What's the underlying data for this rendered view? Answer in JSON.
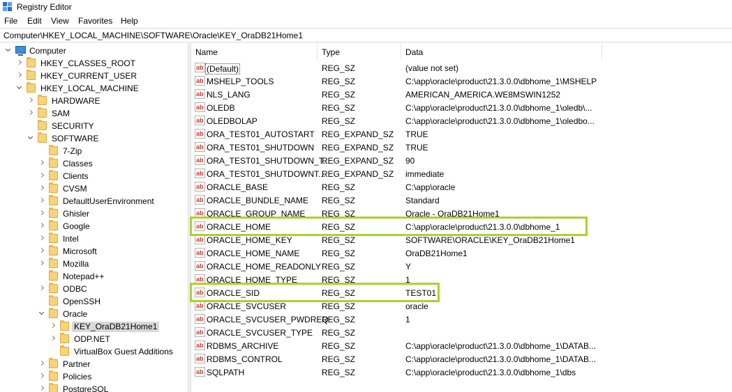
{
  "window": {
    "title": "Registry Editor"
  },
  "menu": [
    "File",
    "Edit",
    "View",
    "Favorites",
    "Help"
  ],
  "address": "Computer\\HKEY_LOCAL_MACHINE\\SOFTWARE\\Oracle\\KEY_OraDB21Home1",
  "tree": [
    {
      "label": "Computer",
      "expander": "open",
      "icon": "computer-icon"
    },
    {
      "label": "HKEY_CLASSES_ROOT",
      "expander": "closed",
      "icon": "folder-icon"
    },
    {
      "label": "HKEY_CURRENT_USER",
      "expander": "closed",
      "icon": "folder-icon"
    },
    {
      "label": "HKEY_LOCAL_MACHINE",
      "expander": "open",
      "icon": "folder-icon"
    },
    {
      "label": "HARDWARE",
      "expander": "closed",
      "icon": "folder-icon"
    },
    {
      "label": "SAM",
      "expander": "closed",
      "icon": "folder-icon"
    },
    {
      "label": "SECURITY",
      "expander": "none",
      "icon": "folder-icon"
    },
    {
      "label": "SOFTWARE",
      "expander": "open",
      "icon": "folder-icon"
    },
    {
      "label": "7-Zip",
      "expander": "none",
      "icon": "folder-icon"
    },
    {
      "label": "Classes",
      "expander": "closed",
      "icon": "folder-icon"
    },
    {
      "label": "Clients",
      "expander": "closed",
      "icon": "folder-icon"
    },
    {
      "label": "CVSM",
      "expander": "closed",
      "icon": "folder-icon"
    },
    {
      "label": "DefaultUserEnvironment",
      "expander": "closed",
      "icon": "folder-icon"
    },
    {
      "label": "Ghisler",
      "expander": "closed",
      "icon": "folder-icon"
    },
    {
      "label": "Google",
      "expander": "closed",
      "icon": "folder-icon"
    },
    {
      "label": "Intel",
      "expander": "closed",
      "icon": "folder-icon"
    },
    {
      "label": "Microsoft",
      "expander": "closed",
      "icon": "folder-icon"
    },
    {
      "label": "Mozilla",
      "expander": "closed",
      "icon": "folder-icon"
    },
    {
      "label": "Notepad++",
      "expander": "none",
      "icon": "folder-icon"
    },
    {
      "label": "ODBC",
      "expander": "closed",
      "icon": "folder-icon"
    },
    {
      "label": "OpenSSH",
      "expander": "none",
      "icon": "folder-icon"
    },
    {
      "label": "Oracle",
      "expander": "open",
      "icon": "folder-icon"
    },
    {
      "label": "KEY_OraDB21Home1",
      "expander": "closed",
      "icon": "folder-icon",
      "selected": true
    },
    {
      "label": "ODP.NET",
      "expander": "closed",
      "icon": "folder-icon"
    },
    {
      "label": "VirtualBox Guest Additions",
      "expander": "none",
      "icon": "folder-icon"
    },
    {
      "label": "Partner",
      "expander": "closed",
      "icon": "folder-icon"
    },
    {
      "label": "Policies",
      "expander": "closed",
      "icon": "folder-icon"
    },
    {
      "label": "PostgreSQL",
      "expander": "closed",
      "icon": "folder-icon"
    }
  ],
  "columns": [
    "Name",
    "Type",
    "Data"
  ],
  "values": [
    {
      "name": "(Default)",
      "type": "REG_SZ",
      "data": "(value not set)"
    },
    {
      "name": "MSHELP_TOOLS",
      "type": "REG_SZ",
      "data": "C:\\app\\oracle\\product\\21.3.0.0\\dbhome_1\\MSHELP"
    },
    {
      "name": "NLS_LANG",
      "type": "REG_SZ",
      "data": "AMERICAN_AMERICA.WE8MSWIN1252"
    },
    {
      "name": "OLEDB",
      "type": "REG_SZ",
      "data": "C:\\app\\oracle\\product\\21.3.0.0\\dbhome_1\\oledb\\..."
    },
    {
      "name": "OLEDBOLAP",
      "type": "REG_SZ",
      "data": "C:\\app\\oracle\\product\\21.3.0.0\\dbhome_1\\oledbo..."
    },
    {
      "name": "ORA_TEST01_AUTOSTART",
      "type": "REG_EXPAND_SZ",
      "data": "TRUE"
    },
    {
      "name": "ORA_TEST01_SHUTDOWN",
      "type": "REG_EXPAND_SZ",
      "data": "TRUE"
    },
    {
      "name": "ORA_TEST01_SHUTDOWN_T...",
      "type": "REG_EXPAND_SZ",
      "data": "90"
    },
    {
      "name": "ORA_TEST01_SHUTDOWNT...",
      "type": "REG_EXPAND_SZ",
      "data": "immediate"
    },
    {
      "name": "ORACLE_BASE",
      "type": "REG_SZ",
      "data": "C:\\app\\oracle"
    },
    {
      "name": "ORACLE_BUNDLE_NAME",
      "type": "REG_SZ",
      "data": "Standard"
    },
    {
      "name": "ORACLE_GROUP_NAME",
      "type": "REG_SZ",
      "data": "Oracle - OraDB21Home1"
    },
    {
      "name": "ORACLE_HOME",
      "type": "REG_SZ",
      "data": "C:\\app\\oracle\\product\\21.3.0.0\\dbhome_1"
    },
    {
      "name": "ORACLE_HOME_KEY",
      "type": "REG_SZ",
      "data": "SOFTWARE\\ORACLE\\KEY_OraDB21Home1"
    },
    {
      "name": "ORACLE_HOME_NAME",
      "type": "REG_SZ",
      "data": "OraDB21Home1"
    },
    {
      "name": "ORACLE_HOME_READONLY",
      "type": "REG_SZ",
      "data": "Y"
    },
    {
      "name": "ORACLE_HOME_TYPE",
      "type": "REG_SZ",
      "data": "1"
    },
    {
      "name": "ORACLE_SID",
      "type": "REG_SZ",
      "data": "TEST01"
    },
    {
      "name": "ORACLE_SVCUSER",
      "type": "REG_SZ",
      "data": "oracle"
    },
    {
      "name": "ORACLE_SVCUSER_PWDREQ",
      "type": "REG_SZ",
      "data": "1"
    },
    {
      "name": "ORACLE_SVCUSER_TYPE",
      "type": "REG_SZ",
      "data": ""
    },
    {
      "name": "RDBMS_ARCHIVE",
      "type": "REG_SZ",
      "data": "C:\\app\\oracle\\product\\21.3.0.0\\dbhome_1\\DATAB..."
    },
    {
      "name": "RDBMS_CONTROL",
      "type": "REG_SZ",
      "data": "C:\\app\\oracle\\product\\21.3.0.0\\dbhome_1\\DATAB..."
    },
    {
      "name": "SQLPATH",
      "type": "REG_SZ",
      "data": "C:\\app\\oracle\\product\\21.3.0.0\\dbhome_1\\dbs"
    }
  ],
  "icon_label": "ab",
  "colors": {
    "highlight": "#a8d428",
    "selection": "#d9d9d9",
    "folder": "#f6d27a"
  }
}
